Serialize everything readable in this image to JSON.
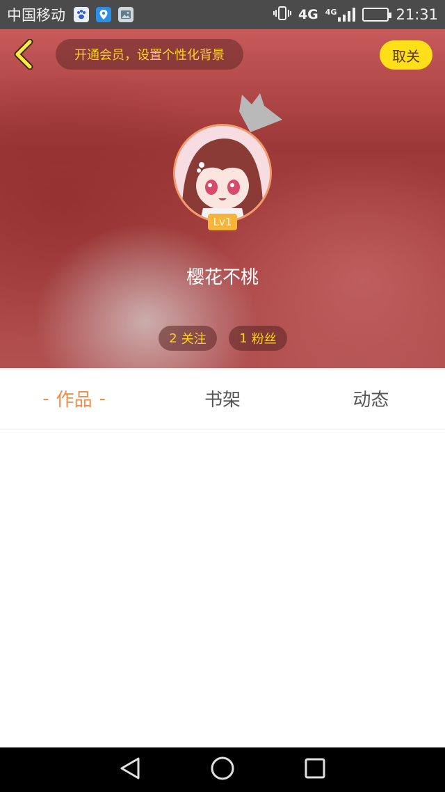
{
  "status_bar": {
    "carrier": "中国移动",
    "network": "4G",
    "network_small": "4G",
    "time": "21:31",
    "icons": [
      "paw-app-icon",
      "map-pin-app-icon",
      "gallery-app-icon",
      "vibrate-icon",
      "signal-icon",
      "battery-charging-icon"
    ]
  },
  "header": {
    "vip_banner": "开通会员，设置个性化背景",
    "unfollow_label": "取关",
    "username": "樱花不桃",
    "level_badge": "Lv1",
    "following_count": "2",
    "following_label": "关注",
    "fans_count": "1",
    "fans_label": "粉丝"
  },
  "tabs": [
    {
      "label": "作品",
      "active": true
    },
    {
      "label": "书架",
      "active": false
    },
    {
      "label": "动态",
      "active": false
    }
  ],
  "tab_dash": "-",
  "colors": {
    "accent_orange": "#f08c4a",
    "vip_yellow": "#ffd21f",
    "button_yellow": "#ffde1a"
  }
}
